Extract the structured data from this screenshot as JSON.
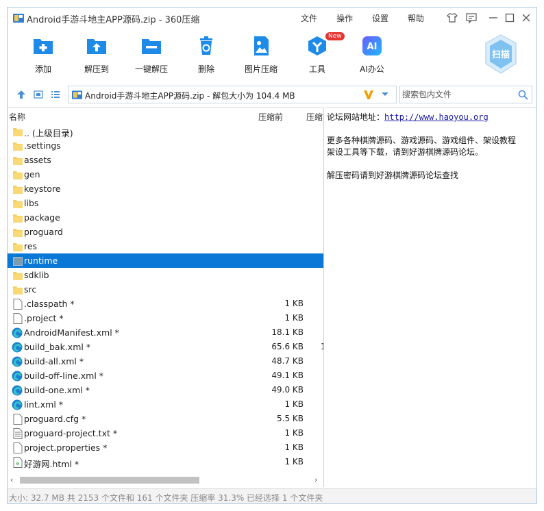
{
  "window": {
    "title": "Android手游斗地主APP源码.zip - 360压缩",
    "menu": [
      "文件",
      "操作",
      "设置",
      "帮助"
    ]
  },
  "toolbar": {
    "buttons": [
      {
        "label": "添加",
        "icon": "add-file-icon"
      },
      {
        "label": "解压到",
        "icon": "extract-to-icon"
      },
      {
        "label": "一键解压",
        "icon": "one-click-extract-icon"
      },
      {
        "label": "删除",
        "icon": "trash-icon"
      },
      {
        "label": "图片压缩",
        "icon": "image-compress-icon"
      },
      {
        "label": "工具",
        "icon": "tools-icon",
        "badge": "New"
      },
      {
        "label": "AI办公",
        "icon": "ai-icon",
        "icon_text": "AI"
      }
    ],
    "scan_label": "扫描"
  },
  "address": {
    "path": "Android手游斗地主APP源码.zip - 解包大小为 104.4 MB",
    "search_placeholder": "搜索包内文件"
  },
  "list": {
    "columns": [
      "名称",
      "压缩前",
      "压缩"
    ],
    "rows": [
      {
        "name": ".. (上级目录)",
        "size": "",
        "type": "folder"
      },
      {
        "name": ".settings",
        "size": "",
        "type": "folder"
      },
      {
        "name": "assets",
        "size": "",
        "type": "folder"
      },
      {
        "name": "gen",
        "size": "",
        "type": "folder"
      },
      {
        "name": "keystore",
        "size": "",
        "type": "folder"
      },
      {
        "name": "libs",
        "size": "",
        "type": "folder"
      },
      {
        "name": "package",
        "size": "",
        "type": "folder"
      },
      {
        "name": "proguard",
        "size": "",
        "type": "folder"
      },
      {
        "name": "res",
        "size": "",
        "type": "folder"
      },
      {
        "name": "runtime",
        "size": "",
        "type": "folder-selected",
        "selected": true
      },
      {
        "name": "sdklib",
        "size": "",
        "type": "folder"
      },
      {
        "name": "src",
        "size": "",
        "type": "folder"
      },
      {
        "name": ".classpath *",
        "size": "1 KB",
        "type": "file"
      },
      {
        "name": ".project *",
        "size": "1 KB",
        "type": "file"
      },
      {
        "name": "AndroidManifest.xml *",
        "size": "18.1 KB",
        "type": "edge"
      },
      {
        "name": "build_bak.xml *",
        "size": "65.6 KB",
        "type": "edge",
        "extra": "1"
      },
      {
        "name": "build-all.xml *",
        "size": "48.7 KB",
        "type": "edge"
      },
      {
        "name": "build-off-line.xml *",
        "size": "49.1 KB",
        "type": "edge"
      },
      {
        "name": "build-one.xml *",
        "size": "49.0 KB",
        "type": "edge"
      },
      {
        "name": "lint.xml *",
        "size": "1 KB",
        "type": "edge"
      },
      {
        "name": "proguard.cfg *",
        "size": "5.5 KB",
        "type": "file"
      },
      {
        "name": "proguard-project.txt *",
        "size": "1 KB",
        "type": "text"
      },
      {
        "name": "project.properties *",
        "size": "1 KB",
        "type": "file"
      },
      {
        "name": "好游网.html *",
        "size": "1 KB",
        "type": "html"
      }
    ]
  },
  "comment": {
    "line1_label": "论坛网站地址：",
    "line1_link": "http://www.haoyou.org",
    "line2": "更多各种棋牌源码、游戏源码、游戏组件、架设教程",
    "line3": "架设工具等下载，请到好游棋牌源码论坛。",
    "line4": "解压密码请到好游棋牌源码论坛查找"
  },
  "status": {
    "text": "大小: 32.7 MB 共 2153 个文件和 161 个文件夹 压缩率 31.3% 已经选择 1 个文件夹"
  },
  "colors": {
    "accent": "#0a78d7",
    "icon_blue": "#1f8be8",
    "folder": "#f7cf5c",
    "badge_red": "#e8322f"
  }
}
